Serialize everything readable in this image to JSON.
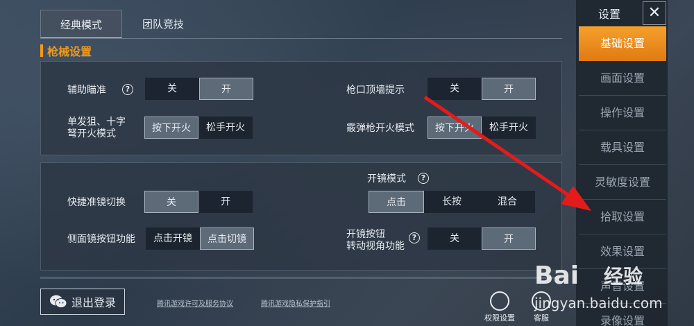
{
  "tabs": [
    {
      "label": "经典模式",
      "active": true
    },
    {
      "label": "团队竞技",
      "active": false
    }
  ],
  "section_title": "枪械设置",
  "panel1": {
    "assist_aim": {
      "label": "辅助瞄准",
      "options": [
        "关",
        "开"
      ],
      "selected": "开"
    },
    "muzzle_wall": {
      "label": "枪口顶墙提示",
      "options": [
        "关",
        "开"
      ],
      "selected": "开"
    },
    "sniper_fire": {
      "label_line1": "单发狙、十字",
      "label_line2": "弩开火模式",
      "options": [
        "按下开火",
        "松手开火"
      ],
      "selected": "按下开火"
    },
    "shotgun_fire": {
      "label": "霰弹枪开火模式",
      "options": [
        "按下开火",
        "松手开火"
      ],
      "selected": "按下开火"
    }
  },
  "panel2": {
    "scope_mode": {
      "label": "开镜模式",
      "options": [
        "点击",
        "长按",
        "混合"
      ],
      "selected": "点击"
    },
    "quick_scope": {
      "label": "快捷准镜切换",
      "options": [
        "关",
        "开"
      ],
      "selected": "关"
    },
    "side_scope": {
      "label": "侧面镜按钮功能",
      "options": [
        "点击开镜",
        "点击切镜"
      ],
      "selected": "点击切镜"
    },
    "scope_rotate": {
      "label_line1": "开镜按钮",
      "label_line2": "转动视角功能",
      "options": [
        "关",
        "开"
      ],
      "selected": "开"
    }
  },
  "footer": {
    "logout": "退出登录",
    "link1": "腾讯游戏许可及服务协议",
    "link2": "腾讯游戏隐私保护指引",
    "permission": "权限设置",
    "service": "客服"
  },
  "sidebar": {
    "title": "设置",
    "close": "✕",
    "items": [
      "基础设置",
      "画面设置",
      "操作设置",
      "载具设置",
      "灵敏度设置",
      "拾取设置",
      "效果设置",
      "声音设置",
      "录像设置"
    ],
    "active_index": 0
  },
  "watermark": {
    "brand": "Bai",
    "cn": "经验",
    "url": "jingyan.baidu.com"
  },
  "colors": {
    "accent": "#f29a1a",
    "arrow": "#e41b1b"
  }
}
